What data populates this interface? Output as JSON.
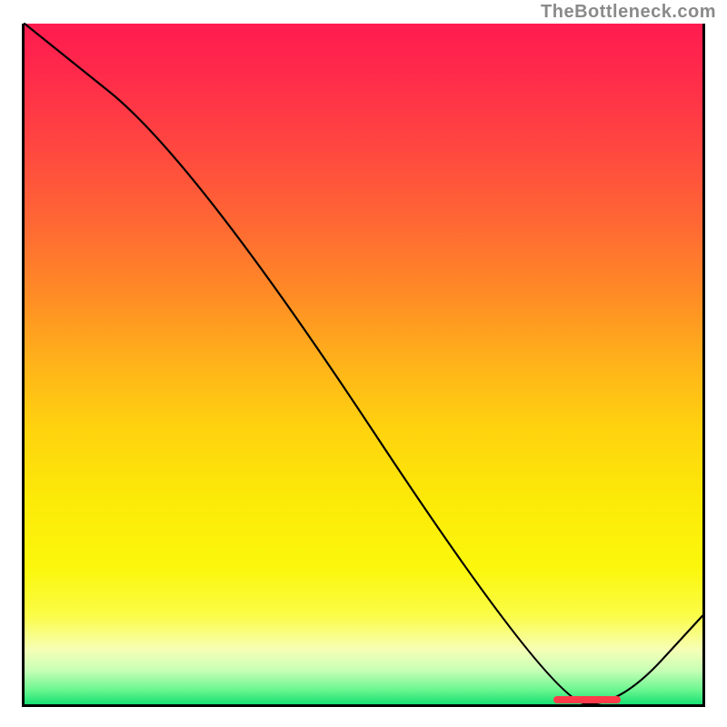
{
  "attribution": "TheBottleneck.com",
  "chart_data": {
    "type": "line",
    "title": "",
    "xlabel": "",
    "ylabel": "",
    "xlim": [
      0,
      100
    ],
    "ylim": [
      0,
      100
    ],
    "x": [
      0,
      25,
      78,
      88,
      100
    ],
    "values": [
      100,
      80,
      0,
      0,
      13
    ],
    "optimal_range": {
      "start": 78,
      "end": 88
    },
    "background": "red-yellow-green vertical gradient (0=green bottom, 100=red top)"
  }
}
